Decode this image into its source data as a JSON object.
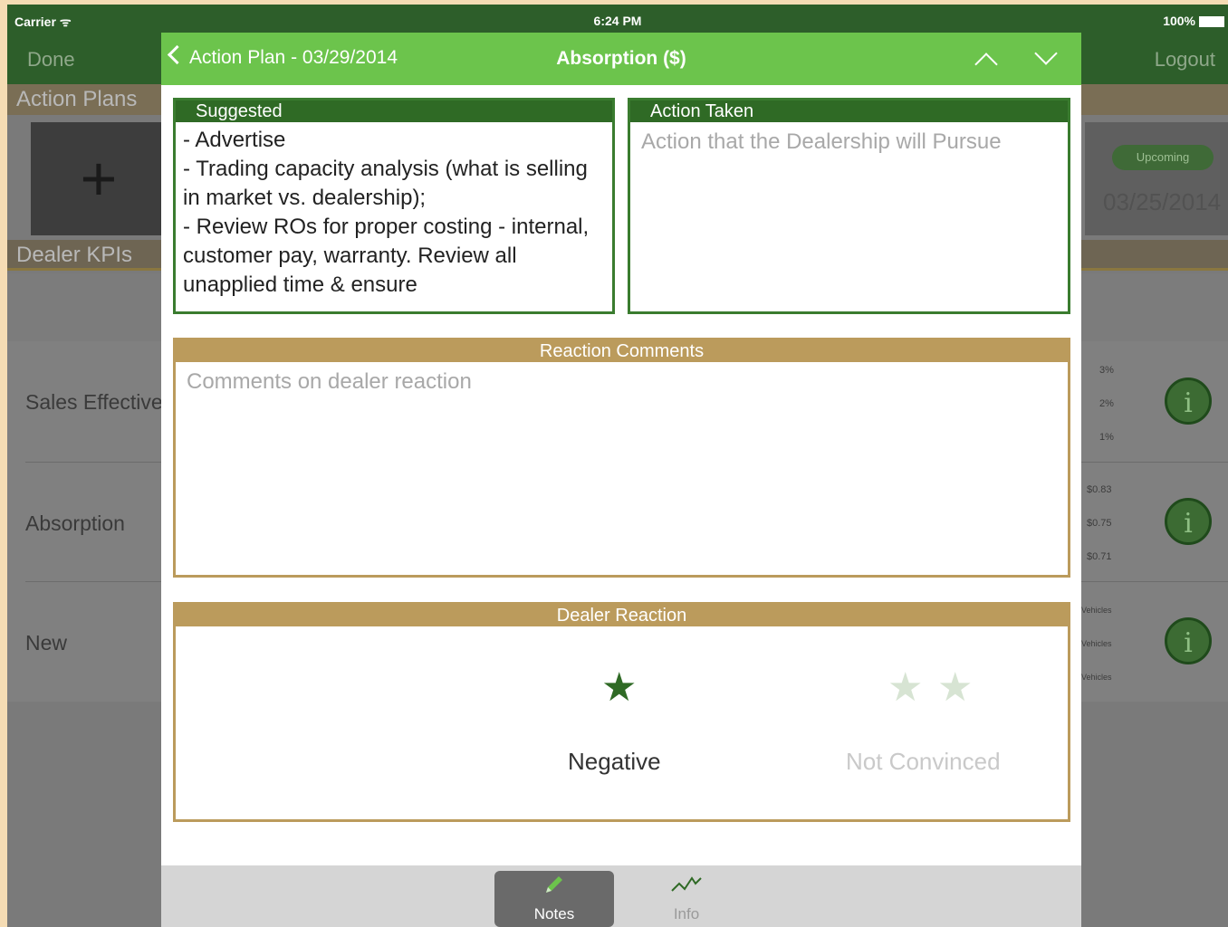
{
  "status_bar": {
    "carrier": "Carrier",
    "time": "6:24 PM",
    "battery": "100%"
  },
  "background": {
    "nav_left": "Done",
    "nav_right": "Logout",
    "section_action_plans": "Action Plans",
    "add_symbol": "+",
    "badge": "Upcoming",
    "date": "03/25/2014",
    "section_kpis": "Dealer KPIs",
    "rows": [
      "Sales Effective",
      "Absorption",
      "New"
    ],
    "ticks_row1": [
      "3%",
      "2%",
      "1%"
    ],
    "ticks_row2": [
      "$0.83",
      "$0.75",
      "$0.71"
    ],
    "ticks_row3": [
      "Vehicles",
      "Vehicles",
      "Vehicles"
    ],
    "info_symbol": "i"
  },
  "modal": {
    "back_label": "Action Plan - 03/29/2014",
    "title": "Absorption ($)",
    "suggested": {
      "heading": "Suggested",
      "text": "- Advertise\n- Trading capacity analysis (what is selling in market vs. dealership);\n- Review ROs for proper costing - internal,  customer pay, warranty. Review all unapplied time & ensure"
    },
    "action_taken": {
      "heading": "Action Taken",
      "placeholder": "Action that the Dealership will Pursue"
    },
    "reaction_comments": {
      "heading": "Reaction Comments",
      "placeholder": "Comments on dealer reaction"
    },
    "dealer_reaction": {
      "heading": "Dealer Reaction",
      "options": [
        {
          "label": "Negative",
          "stars": 1,
          "selected": true
        },
        {
          "label": "Not Convinced",
          "stars": 2,
          "selected": false
        }
      ],
      "star_glyph": "★",
      "colors": {
        "selected": "#2f6a25",
        "unselected": "#d7e4d3"
      }
    },
    "tabs": [
      {
        "label": "Notes",
        "icon": "pencil-icon",
        "active": true
      },
      {
        "label": "Info",
        "icon": "chart-line-icon",
        "active": false
      }
    ]
  },
  "colors": {
    "header_green": "#6cc44c",
    "panel_green": "#2f6a25",
    "panel_gold": "#bb9b5c"
  }
}
